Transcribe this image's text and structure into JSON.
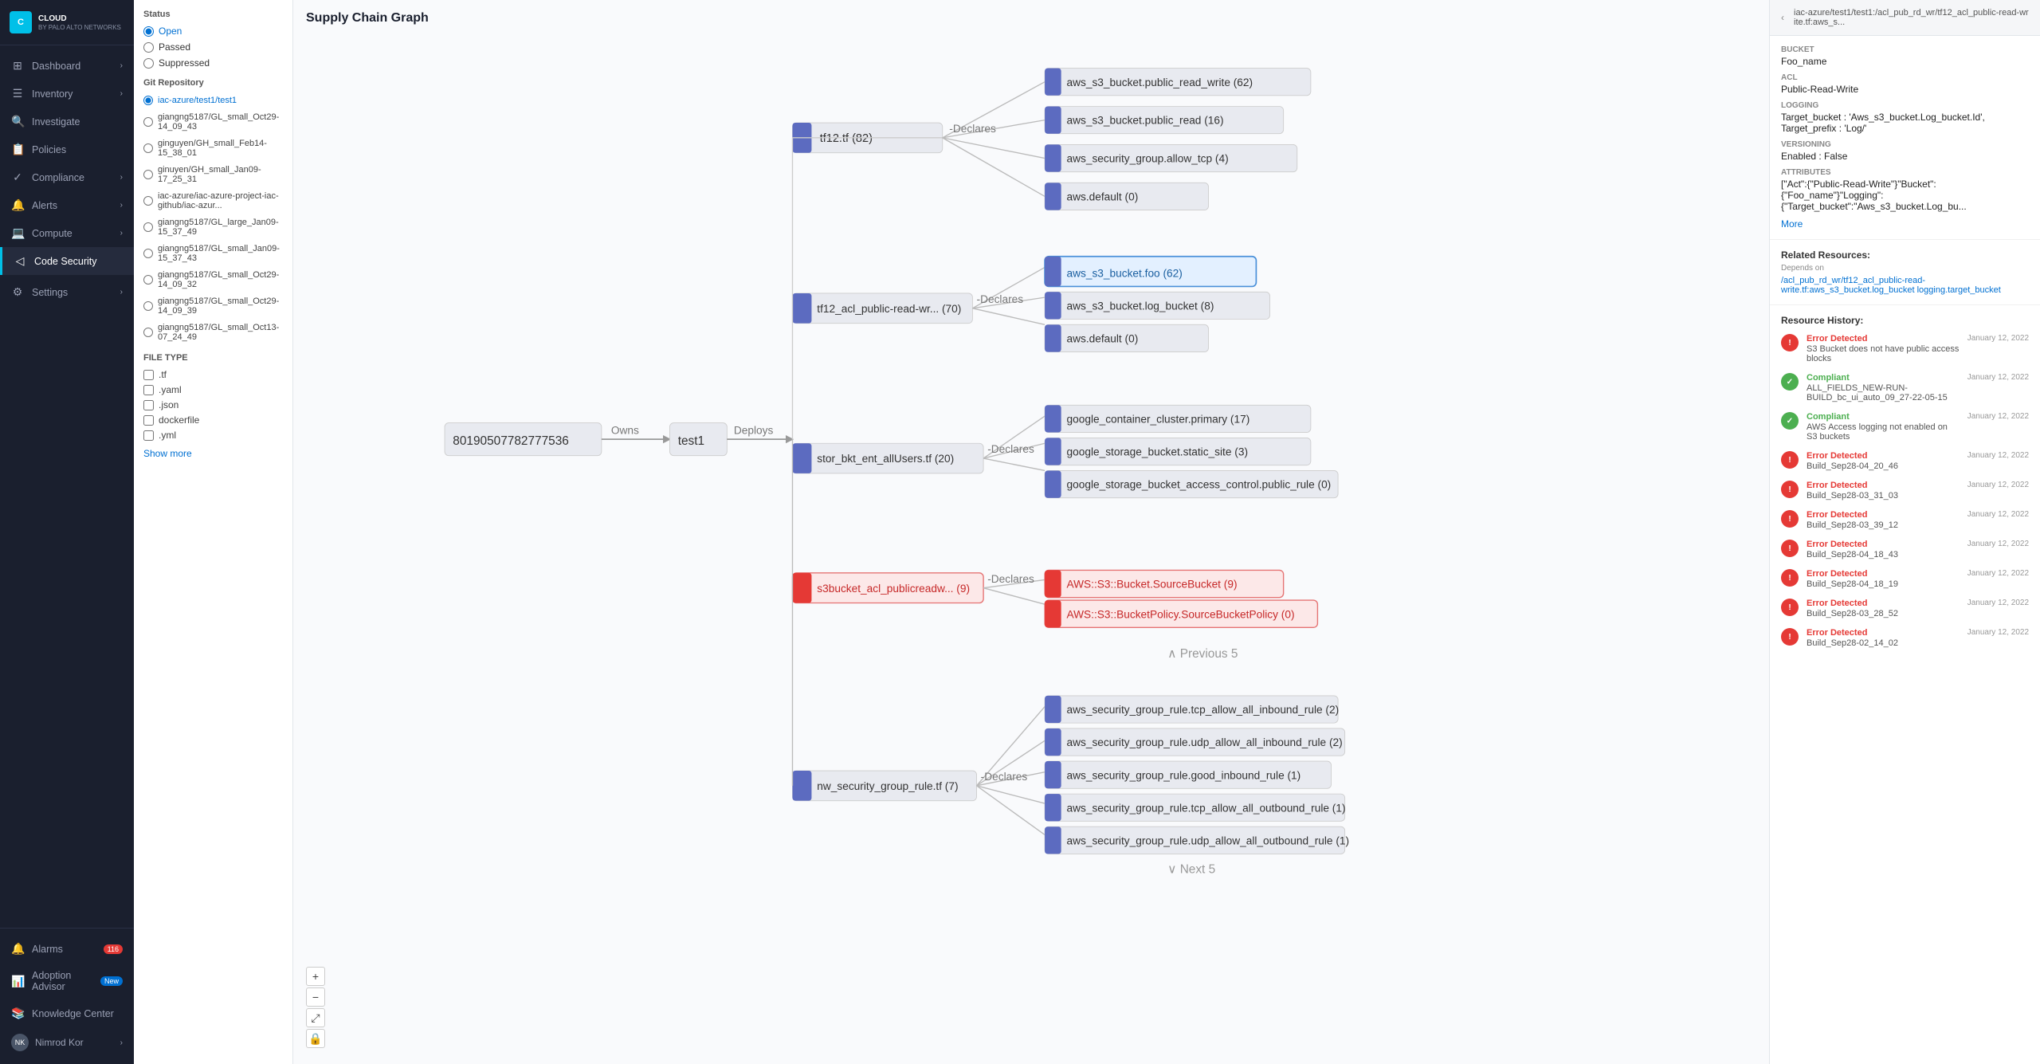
{
  "sidebar": {
    "logo": {
      "icon": "C",
      "name": "CLOUD",
      "sub": "BY PALO ALTO NETWORKS"
    },
    "nav_items": [
      {
        "id": "dashboard",
        "label": "Dashboard",
        "icon": "⊞",
        "has_chevron": true
      },
      {
        "id": "inventory",
        "label": "Inventory",
        "icon": "☰",
        "has_chevron": true
      },
      {
        "id": "investigate",
        "label": "Investigate",
        "icon": "🔍",
        "has_chevron": false
      },
      {
        "id": "policies",
        "label": "Policies",
        "icon": "📋",
        "has_chevron": false
      },
      {
        "id": "compliance",
        "label": "Compliance",
        "icon": "✓",
        "has_chevron": true
      },
      {
        "id": "alerts",
        "label": "Alerts",
        "icon": "🔔",
        "has_chevron": true
      },
      {
        "id": "compute",
        "label": "Compute",
        "icon": "💻",
        "has_chevron": true
      },
      {
        "id": "code-security",
        "label": "Code Security",
        "icon": "◁",
        "active": true,
        "has_chevron": false
      }
    ],
    "bottom_items": [
      {
        "id": "alarms",
        "label": "Alarms",
        "icon": "🔔",
        "badge": "116"
      },
      {
        "id": "adoption-advisor",
        "label": "Adoption Advisor",
        "icon": "📊",
        "badge_new": "New"
      },
      {
        "id": "knowledge-center",
        "label": "Knowledge Center",
        "icon": "📚"
      },
      {
        "id": "settings",
        "label": "Settings",
        "icon": "⚙",
        "has_chevron": true
      }
    ],
    "user": {
      "name": "Nimrod Kor",
      "initials": "NK"
    }
  },
  "filter": {
    "status_title": "Status",
    "status_options": [
      {
        "id": "open",
        "label": "Open",
        "selected": true
      },
      {
        "id": "passed",
        "label": "Passed",
        "selected": false
      },
      {
        "id": "suppressed",
        "label": "Suppressed",
        "selected": false
      }
    ],
    "git_repo_title": "Git Repository",
    "git_repos": [
      {
        "id": "iac-azure-test1",
        "label": "iac-azure/test1/test1",
        "selected": true
      },
      {
        "id": "giangng5187-oct29",
        "label": "giangng5187/GL_small_Oct29-14_09_43",
        "selected": false
      },
      {
        "id": "ginguyen-feb14",
        "label": "ginguyen/GH_small_Feb14-15_38_01",
        "selected": false
      },
      {
        "id": "ginguyen-jan09",
        "label": "ginuyen/GH_small_Jan09-17_25_31",
        "selected": false
      },
      {
        "id": "iac-azure-github",
        "label": "iac-azure/iac-azure-project-iac-github/iac-azur...",
        "selected": false
      },
      {
        "id": "giangng-large",
        "label": "giangng5187/GL_large_Jan09-15_37_49",
        "selected": false
      },
      {
        "id": "giangng-jan09-37",
        "label": "giangng5187/GL_small_Jan09-15_37_43",
        "selected": false
      },
      {
        "id": "giangng-oct29-32",
        "label": "giangng5187/GL_small_Oct29-14_09_32",
        "selected": false
      },
      {
        "id": "giangng-oct29-39",
        "label": "giangng5187/GL_small_Oct29-14_09_39",
        "selected": false
      },
      {
        "id": "giangng-oct13",
        "label": "giangng5187/GL_small_Oct13-07_24_49",
        "selected": false
      }
    ],
    "file_type_title": "FILE TYPE",
    "file_types": [
      {
        "id": "tf",
        "label": ".tf",
        "checked": false
      },
      {
        "id": "yaml",
        "label": ".yaml",
        "checked": false
      },
      {
        "id": "json",
        "label": ".json",
        "checked": false
      },
      {
        "id": "dockerfile",
        "label": "dockerfile",
        "checked": false
      },
      {
        "id": "yml",
        "label": ".yml",
        "checked": false
      }
    ],
    "show_more_label": "Show more"
  },
  "graph": {
    "title": "Supply Chain Graph",
    "root_node": "80190507782777536",
    "zoom_controls": [
      "+",
      "−",
      "⤢",
      "🔒"
    ]
  },
  "right_panel": {
    "header_path": "iac-azure/test1/test1:/acl_pub_rd_wr/tf12_acl_public-read-write.tf:aws_s...",
    "bucket_label": "Bucket",
    "bucket_value": "Foo_name",
    "acl_label": "ACL",
    "acl_value": "Public-Read-Write",
    "logging_label": "Logging",
    "logging_value": "Target_bucket : 'Aws_s3_bucket.Log_bucket.Id', Target_prefix : 'Log/'",
    "versioning_label": "Versioning",
    "versioning_value": "Enabled : False",
    "attributes_label": "Attributes",
    "attributes_value": "[\"Act\":{\"Public-Read-Write\"}\"Bucket\":{\"Foo_name\"}\"Logging\":{\"Target_bucket\":\"Aws_s3_bucket.Log_bu...",
    "more_label": "More",
    "related_resources_title": "Related Resources:",
    "depends_on_label": "Depends on",
    "depends_on_value": "/acl_pub_rd_wr/tf12_acl_public-read-write.tf:aws_s3_bucket.log_bucket logging.target_bucket",
    "resource_history_title": "Resource History:",
    "history_items": [
      {
        "type": "error",
        "status": "Error Detected",
        "desc": "S3 Bucket does not have public access blocks",
        "date": "January 12, 2022"
      },
      {
        "type": "compliant",
        "status": "Compliant",
        "desc": "ALL_FIELDS_NEW-RUN-BUILD_bc_ui_auto_09_27-22-05-15",
        "date": "January 12, 2022"
      },
      {
        "type": "compliant",
        "status": "Compliant",
        "desc": "AWS Access logging not enabled on S3 buckets",
        "date": "January 12, 2022"
      },
      {
        "type": "error",
        "status": "Error Detected",
        "desc": "Build_Sep28-04_20_46",
        "date": "January 12, 2022"
      },
      {
        "type": "error",
        "status": "Error Detected",
        "desc": "Build_Sep28-03_31_03",
        "date": "January 12, 2022"
      },
      {
        "type": "error",
        "status": "Error Detected",
        "desc": "Build_Sep28-03_39_12",
        "date": "January 12, 2022"
      },
      {
        "type": "error",
        "status": "Error Detected",
        "desc": "Build_Sep28-04_18_43",
        "date": "January 12, 2022"
      },
      {
        "type": "error",
        "status": "Error Detected",
        "desc": "Build_Sep28-04_18_19",
        "date": "January 12, 2022"
      },
      {
        "type": "error",
        "status": "Error Detected",
        "desc": "Build_Sep28-03_28_52",
        "date": "January 12, 2022"
      },
      {
        "type": "error",
        "status": "Error Detected",
        "desc": "Build_Sep28-02_14_02",
        "date": "January 12, 2022"
      }
    ]
  }
}
